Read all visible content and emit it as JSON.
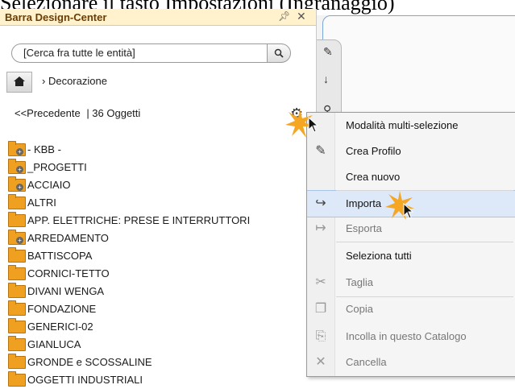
{
  "caption": "Selezionare il tasto Impostazioni (Ingranaggio)",
  "panel": {
    "title": "Barra Design-Center",
    "pin_icon": "pin-icon",
    "close_icon": "close-icon",
    "search_placeholder": "[Cerca fra tutte le entità]",
    "breadcrumb": "Decorazione",
    "nav_previous": "<<Precedente",
    "nav_count": "| 36 Oggetti",
    "items": [
      {
        "label": "- KBB -",
        "sub": true
      },
      {
        "label": "_PROGETTI",
        "sub": true
      },
      {
        "label": "ACCIAIO",
        "sub": true
      },
      {
        "label": "ALTRI",
        "sub": false
      },
      {
        "label": "APP. ELETTRICHE: PRESE E INTERRUTTORI",
        "sub": false
      },
      {
        "label": "ARREDAMENTO",
        "sub": true
      },
      {
        "label": "BATTISCOPA",
        "sub": false
      },
      {
        "label": "CORNICI-TETTO",
        "sub": false
      },
      {
        "label": "DIVANI WENGA",
        "sub": false
      },
      {
        "label": "FONDAZIONE",
        "sub": false
      },
      {
        "label": "GENERICI-02",
        "sub": false
      },
      {
        "label": "GIANLUCA",
        "sub": false
      },
      {
        "label": "GRONDE e SCOSSALINE",
        "sub": false
      },
      {
        "label": "OGGETTI INDUSTRIALI",
        "sub": false
      }
    ]
  },
  "menu": {
    "items": [
      {
        "label": "Modalità multi-selezione",
        "icon": "",
        "disabled": false
      },
      {
        "label": "Crea Profilo",
        "icon": "profile-icon",
        "disabled": false
      },
      {
        "label": "Crea nuovo",
        "icon": "",
        "disabled": false
      },
      {
        "label": "Importa",
        "icon": "import-icon",
        "disabled": false
      },
      {
        "label": "Esporta",
        "icon": "export-icon",
        "disabled": true
      },
      {
        "label": "Seleziona tutti",
        "icon": "",
        "disabled": false
      },
      {
        "label": "Taglia",
        "icon": "scissors-icon",
        "disabled": true
      },
      {
        "label": "Copia",
        "icon": "copy-icon",
        "disabled": true
      },
      {
        "label": "Incolla in questo Catalogo",
        "icon": "paste-icon",
        "disabled": true
      },
      {
        "label": "Cancella",
        "icon": "delete-icon",
        "disabled": true
      }
    ]
  },
  "colors": {
    "title_bar": "#fff2cc",
    "title_text": "#6a3d05",
    "folder": "#f0a020",
    "highlight": "#dde9f8",
    "burst": "#f5a623"
  }
}
